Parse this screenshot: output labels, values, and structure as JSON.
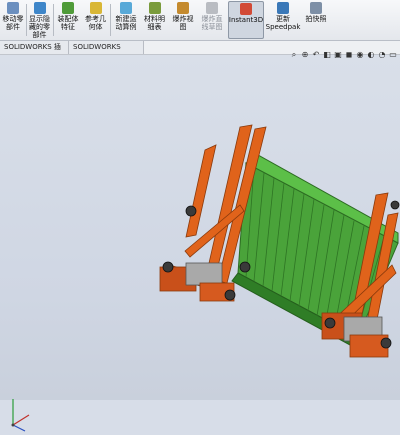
{
  "toolbar": {
    "buttons": [
      {
        "label": "移动零\n部件",
        "icon": "move-component-icon"
      },
      {
        "label": "显示隐\n藏的零\n部件",
        "icon": "show-hidden-icon"
      },
      {
        "label": "装配体\n特征",
        "icon": "assembly-features-icon"
      },
      {
        "label": "参考几\n何体",
        "icon": "reference-geometry-icon"
      },
      {
        "label": "新建运\n动算例",
        "icon": "motion-study-icon"
      },
      {
        "label": "材料明\n细表",
        "icon": "bom-icon"
      },
      {
        "label": "爆炸视\n图",
        "icon": "exploded-view-icon"
      },
      {
        "label": "爆炸直\n线草图",
        "icon": "explode-line-sketch-icon"
      },
      {
        "label": "Instant3D",
        "icon": "instant3d-icon"
      },
      {
        "label": "更新\nSpeedpak",
        "icon": "speedpak-icon"
      },
      {
        "label": "拍快照",
        "icon": "snapshot-icon"
      }
    ]
  },
  "tabs": [
    "SOLIDWORKS 插件",
    "SOLIDWORKS MBD"
  ],
  "colors": {
    "frame": "#e0631b",
    "container": "#4aa33a",
    "container_dark": "#2f7d26",
    "background": "#d7dde8"
  }
}
